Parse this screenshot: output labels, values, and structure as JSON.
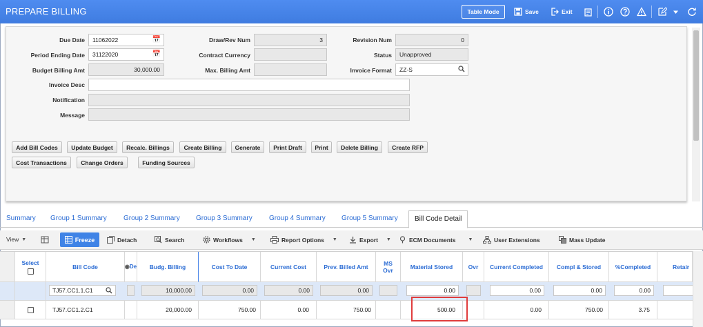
{
  "window": {
    "title": "PREPARE BILLING",
    "table_mode": "Table Mode",
    "save": "Save",
    "exit": "Exit"
  },
  "form": {
    "due_date_label": "Due Date",
    "due_date": "11062022",
    "period_ending_label": "Period Ending Date",
    "period_ending": "31122020",
    "budget_billing_label": "Budget Billing Amt",
    "budget_billing": "30,000.00",
    "draw_rev_label": "Draw/Rev Num",
    "draw_rev": "3",
    "contract_currency_label": "Contract Currency",
    "contract_currency": "",
    "max_billing_label": "Max. Billing Amt",
    "max_billing": "",
    "revision_label": "Revision Num",
    "revision": "0",
    "status_label": "Status",
    "status": "Unapproved",
    "invoice_format_label": "Invoice Format",
    "invoice_format": "ZZ-S",
    "invoice_desc_label": "Invoice Desc",
    "invoice_desc": "",
    "notification_label": "Notification",
    "notification": "",
    "message_label": "Message",
    "message": ""
  },
  "actions": [
    "Add Bill Codes",
    "Update Budget",
    "Recalc. Billings",
    "Create Billing",
    "Generate",
    "Print Draft",
    "Print",
    "Delete Billing",
    "Create RFP",
    "Cost Transactions",
    "Change Orders",
    "Funding Sources"
  ],
  "tabs": [
    "Summary",
    "Group 1 Summary",
    "Group 2 Summary",
    "Group 3 Summary",
    "Group 4 Summary",
    "Group 5 Summary",
    "Bill Code Detail"
  ],
  "toolbar": {
    "view": "View",
    "freeze": "Freeze",
    "detach": "Detach",
    "search": "Search",
    "workflows": "Workflows",
    "report_options": "Report Options",
    "export": "Export",
    "ecm_documents": "ECM Documents",
    "user_extensions": "User Extensions",
    "mass_update": "Mass Update"
  },
  "grid": {
    "headers": {
      "select": "Select",
      "bill_code": "Bill Code",
      "de": "De",
      "budg_billing": "Budg. Billing",
      "cost_to_date": "Cost To Date",
      "current_cost": "Current Cost",
      "prev_billed": "Prev. Billed Amt",
      "ms_ovr": "MS Ovr",
      "material_stored": "Material Stored",
      "ovr": "Ovr",
      "current_completed": "Current Completed",
      "compl_stored": "Compl & Stored",
      "pct_completed": "%Completed",
      "retain": "Retair"
    },
    "rows": [
      {
        "bill_code": "TJ57.CC1.1.C1",
        "budg_billing": "10,000.00",
        "cost_to_date": "0.00",
        "current_cost": "0.00",
        "prev_billed": "0.00",
        "material_stored": "0.00",
        "current_completed": "0.00",
        "compl_stored": "0.00",
        "pct_completed": "0.00"
      },
      {
        "bill_code": "TJ57.CC1.2.C1",
        "budg_billing": "20,000.00",
        "cost_to_date": "750.00",
        "current_cost": "0.00",
        "prev_billed": "750.00",
        "material_stored": "500.00",
        "current_completed": "0.00",
        "compl_stored": "750.00",
        "pct_completed": "3.75"
      }
    ]
  }
}
